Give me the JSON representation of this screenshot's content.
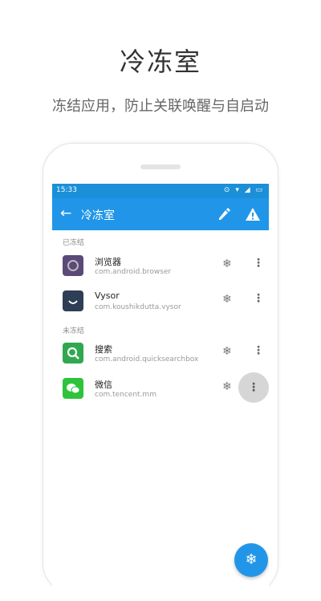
{
  "promo": {
    "title": "冷冻室",
    "subtitle": "冻结应用，防止关联唤醒与自启动"
  },
  "status_bar": {
    "time": "15:33",
    "icons": "⊙ ▾ ◢ ▭"
  },
  "toolbar": {
    "back_glyph": "←",
    "title": "冷冻室"
  },
  "sections": {
    "frozen": "已冻结",
    "unfrozen": "未冻结"
  },
  "apps": [
    {
      "name": "浏览器",
      "package": "com.android.browser",
      "icon": "browser-icon",
      "color": "#5a4a78"
    },
    {
      "name": "Vysor",
      "package": "com.koushikdutta.vysor",
      "icon": "vysor-icon",
      "color": "#2e3e54"
    },
    {
      "name": "搜索",
      "package": "com.android.quicksearchbox",
      "icon": "search-icon",
      "color": "#2fa84f"
    },
    {
      "name": "微信",
      "package": "com.tencent.mm",
      "icon": "wechat-icon",
      "color": "#2ec33a"
    }
  ],
  "glyphs": {
    "freeze": "❄",
    "more": "⋮"
  },
  "colors": {
    "accent": "#2196e9",
    "status_bar": "#1b8fd8"
  }
}
